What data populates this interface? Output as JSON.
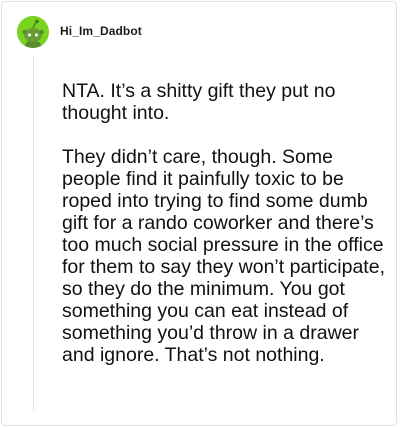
{
  "comment": {
    "author": "Hi_Im_Dadbot",
    "avatar_icon": "reddit-snoo-icon",
    "avatar_color": "#79d321",
    "paragraphs": [
      "NTA. It’s a shitty gift they put no thought into.",
      "They didn’t care, though. Some people find it painfully toxic to be roped into trying to find some dumb gift for a rando coworker and there’s too much social pressure in the office for them to say they won’t participate, so they do the minimum. You got something you can eat instead of something you’d throw in a drawer and ignore. That’s not nothing."
    ]
  }
}
